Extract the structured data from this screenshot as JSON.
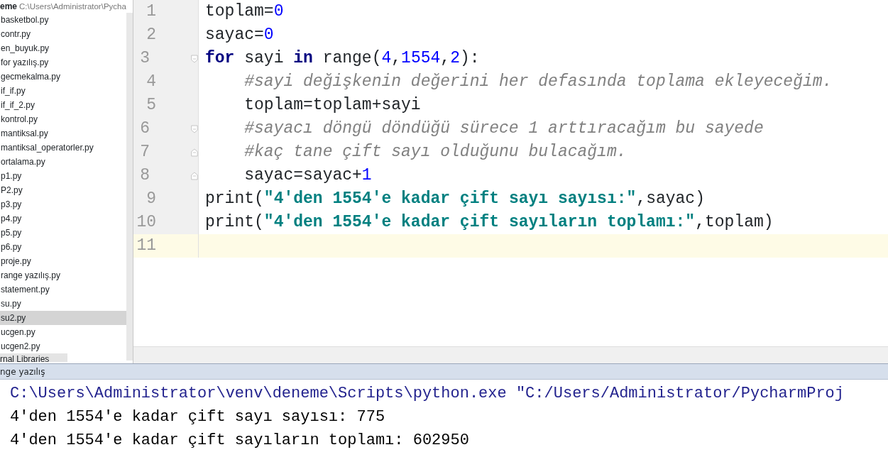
{
  "project_header": {
    "name": "eme",
    "path": "C:\\Users\\Administrator\\Pycha"
  },
  "files": [
    {
      "label": "basketbol.py",
      "selected": false
    },
    {
      "label": "contr.py",
      "selected": false
    },
    {
      "label": "en_buyuk.py",
      "selected": false
    },
    {
      "label": "for yazılış.py",
      "selected": false
    },
    {
      "label": "gecmekalma.py",
      "selected": false
    },
    {
      "label": "if_if.py",
      "selected": false
    },
    {
      "label": "if_if_2.py",
      "selected": false
    },
    {
      "label": "kontrol.py",
      "selected": false
    },
    {
      "label": "mantiksal.py",
      "selected": false
    },
    {
      "label": "mantiksal_operatorler.py",
      "selected": false
    },
    {
      "label": "ortalama.py",
      "selected": false
    },
    {
      "label": "p1.py",
      "selected": false
    },
    {
      "label": "P2.py",
      "selected": false
    },
    {
      "label": "p3.py",
      "selected": false
    },
    {
      "label": "p4.py",
      "selected": false
    },
    {
      "label": "p5.py",
      "selected": false
    },
    {
      "label": "p6.py",
      "selected": false
    },
    {
      "label": "proje.py",
      "selected": false
    },
    {
      "label": "range yazılış.py",
      "selected": false
    },
    {
      "label": "statement.py",
      "selected": false
    },
    {
      "label": "su.py",
      "selected": false
    },
    {
      "label": "su2.py",
      "selected": true
    },
    {
      "label": "ucgen.py",
      "selected": false
    },
    {
      "label": "ucgen2.py",
      "selected": false
    }
  ],
  "external_libraries": "rnal Libraries",
  "editor": {
    "lines": [
      {
        "number": "1",
        "current": false,
        "kind": "plain",
        "tokens": [
          {
            "kind": "plain",
            "text": "toplam="
          },
          {
            "kind": "number",
            "text": "0"
          }
        ]
      },
      {
        "number": "2",
        "current": false,
        "kind": "plain",
        "tokens": [
          {
            "kind": "plain",
            "text": "sayac="
          },
          {
            "kind": "number",
            "text": "0"
          }
        ]
      },
      {
        "number": "3",
        "current": false,
        "kind": "fold-start",
        "tokens": [
          {
            "kind": "keyword",
            "text": "for"
          },
          {
            "kind": "plain",
            "text": " sayi "
          },
          {
            "kind": "keyword",
            "text": "in"
          },
          {
            "kind": "plain",
            "text": " range("
          },
          {
            "kind": "number",
            "text": "4"
          },
          {
            "kind": "plain",
            "text": ","
          },
          {
            "kind": "number",
            "text": "1554"
          },
          {
            "kind": "plain",
            "text": ","
          },
          {
            "kind": "number",
            "text": "2"
          },
          {
            "kind": "plain",
            "text": "):"
          }
        ]
      },
      {
        "number": "4",
        "current": false,
        "kind": "plain",
        "tokens": [
          {
            "kind": "comment",
            "text": "    #sayi değişkenin değerini her defasında toplama ekleyeceğim."
          }
        ]
      },
      {
        "number": "5",
        "current": false,
        "kind": "plain",
        "tokens": [
          {
            "kind": "plain",
            "text": "    toplam=toplam+sayi"
          }
        ]
      },
      {
        "number": "6",
        "current": false,
        "kind": "fold-start",
        "tokens": [
          {
            "kind": "comment",
            "text": "    #sayacı döngü döndüğü sürece 1 arttıracağım bu sayede"
          }
        ]
      },
      {
        "number": "7",
        "current": false,
        "kind": "fold-end",
        "tokens": [
          {
            "kind": "comment",
            "text": "    #kaç tane çift sayı olduğunu bulacağım."
          }
        ]
      },
      {
        "number": "8",
        "current": false,
        "kind": "fold-end",
        "tokens": [
          {
            "kind": "plain",
            "text": "    sayac=sayac+"
          },
          {
            "kind": "number",
            "text": "1"
          }
        ]
      },
      {
        "number": "9",
        "current": false,
        "kind": "plain",
        "tokens": [
          {
            "kind": "plain",
            "text": "print("
          },
          {
            "kind": "string",
            "text": "\"4'den 1554'e kadar çift sayı sayısı:\""
          },
          {
            "kind": "plain",
            "text": ",sayac)"
          }
        ]
      },
      {
        "number": "10",
        "current": false,
        "kind": "plain",
        "tokens": [
          {
            "kind": "plain",
            "text": "print("
          },
          {
            "kind": "string",
            "text": "\"4'den 1554'e kadar çift sayıların toplamı:\""
          },
          {
            "kind": "plain",
            "text": ",toplam)"
          }
        ]
      },
      {
        "number": "11",
        "current": true,
        "kind": "plain"
      }
    ]
  },
  "run_tab": {
    "label": "nge yazılış"
  },
  "console": [
    {
      "kind": "command",
      "text": "C:\\Users\\Administrator\\venv\\deneme\\Scripts\\python.exe \"C:/Users/Administrator/PycharmProj"
    },
    {
      "kind": "output",
      "text": "4'den 1554'e kadar çift sayı sayısı: 775"
    },
    {
      "kind": "output",
      "text": "4'den 1554'e kadar çift sayıların toplamı: 602950"
    }
  ]
}
